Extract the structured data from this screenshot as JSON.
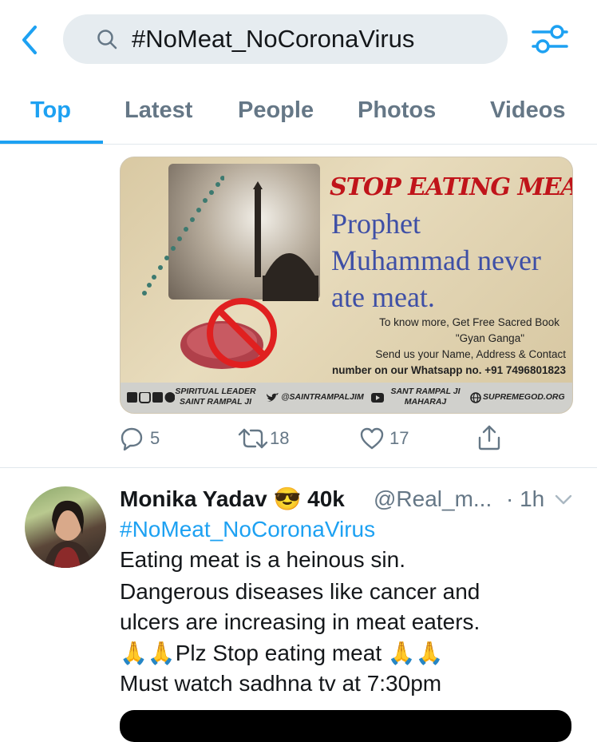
{
  "search": {
    "query": "#NoMeat_NoCoronaVirus"
  },
  "tabs": [
    {
      "label": "Top"
    },
    {
      "label": "Latest"
    },
    {
      "label": "People"
    },
    {
      "label": "Photos"
    },
    {
      "label": "Videos"
    }
  ],
  "promo": {
    "headline": "STOP EATING MEAT!",
    "line1": "Prophet",
    "line2": "Muhammad never",
    "line3": "ate meat.",
    "info1": "To know more, Get Free Sacred Book",
    "info2": "\"Gyan Ganga\"",
    "info3": "Send us your Name, Address & Contact",
    "info4": "number on our Whatsapp no. +91 7496801823",
    "footer1a": "SPIRITUAL LEADER",
    "footer1b": "SAINT RAMPAL JI",
    "footer2": "@SAINTRAMPALJIM",
    "footer3a": "SANT RAMPAL JI",
    "footer3b": "MAHARAJ",
    "footer4": "SUPREMEGOD.ORG"
  },
  "actions": {
    "replies": "5",
    "retweets": "18",
    "likes": "17"
  },
  "tweet": {
    "author": "Monika Yadav",
    "emoji": "😎",
    "followers_tag": "40k",
    "handle": "@Real_m...",
    "time": "· 1h",
    "hashtag": "#NoMeat_NoCoronaVirus",
    "lines": [
      "Eating meat is a heinous sin.",
      "Dangerous diseases like cancer and",
      "ulcers are increasing in meat eaters.",
      "🙏🙏Plz Stop eating meat 🙏🙏",
      "Must watch sadhna tv at 7:30pm"
    ]
  },
  "colors": {
    "accent": "#1da1f2",
    "muted": "#657786",
    "text": "#14171a"
  }
}
